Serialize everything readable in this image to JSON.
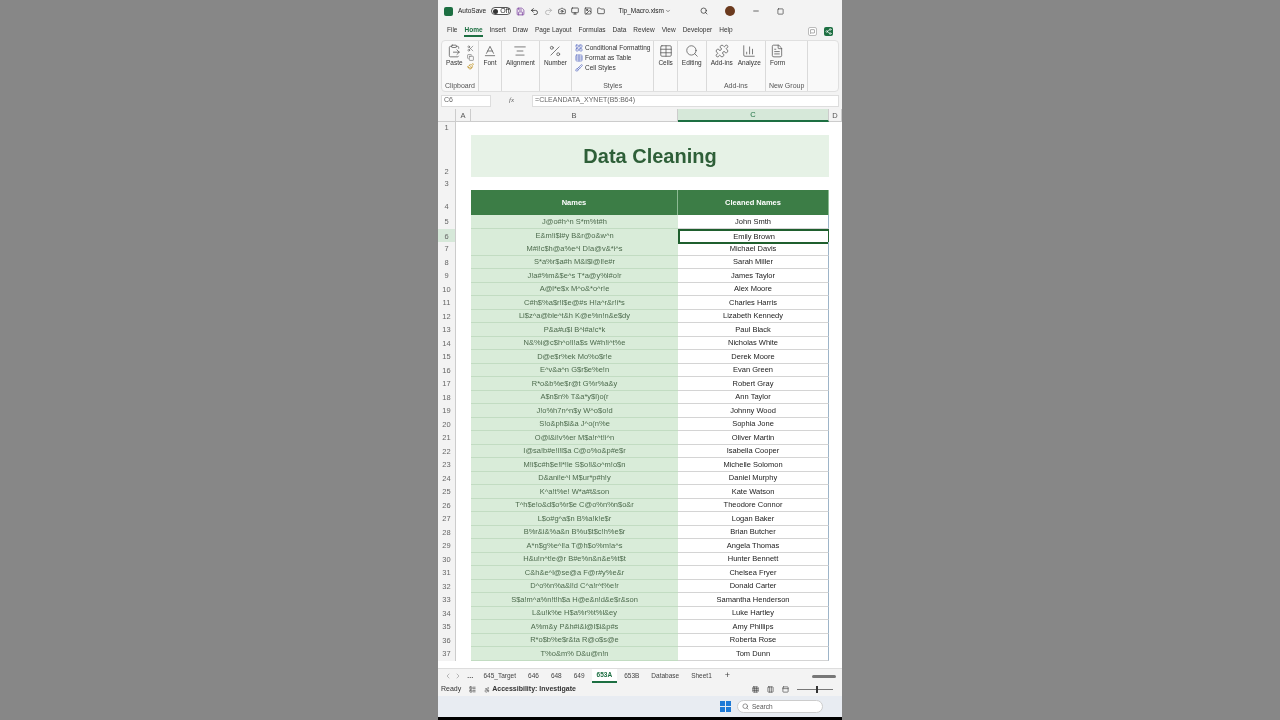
{
  "title_bar": {
    "autosave_label": "AutoSave",
    "autosave": {
      "on": false,
      "label": "Off"
    },
    "file_name": "Tip_Macro.xlsm"
  },
  "menu_tabs": [
    {
      "label": "File",
      "selected": false
    },
    {
      "label": "Home",
      "selected": true
    },
    {
      "label": "Insert",
      "selected": false
    },
    {
      "label": "Draw",
      "selected": false
    },
    {
      "label": "Page Layout",
      "selected": false
    },
    {
      "label": "Formulas",
      "selected": false
    },
    {
      "label": "Data",
      "selected": false
    },
    {
      "label": "Review",
      "selected": false
    },
    {
      "label": "View",
      "selected": false
    },
    {
      "label": "Developer",
      "selected": false
    },
    {
      "label": "Help",
      "selected": false
    }
  ],
  "ribbon": [
    {
      "kind": "clipboard",
      "label": "Clipboard",
      "buttons": [
        "Paste"
      ]
    },
    {
      "kind": "large",
      "buttons": [
        "Font"
      ]
    },
    {
      "kind": "large",
      "buttons": [
        "Alignment"
      ]
    },
    {
      "kind": "large",
      "buttons": [
        "Number"
      ]
    },
    {
      "kind": "list",
      "label": "Styles",
      "buttons": [
        "Conditional Formatting",
        "Format as Table",
        "Cell Styles"
      ]
    },
    {
      "kind": "large",
      "buttons": [
        "Cells"
      ]
    },
    {
      "kind": "large",
      "buttons": [
        "Editing"
      ]
    },
    {
      "kind": "large",
      "label": "Add-ins",
      "buttons": [
        "Add-ins",
        "Analyze"
      ]
    },
    {
      "kind": "large",
      "label": "New Group",
      "buttons": [
        "Form"
      ]
    }
  ],
  "formula_bar": {
    "name_box": "C6",
    "fx": "fx",
    "formula": "=CLEANDATA_XYNET(B5:B64)"
  },
  "sheet": {
    "columns": [
      {
        "label": "A",
        "selected": false
      },
      {
        "label": "B",
        "selected": false
      },
      {
        "label": "C",
        "selected": true
      },
      {
        "label": "D",
        "selected": false
      }
    ],
    "title_rows": [
      "1",
      "2",
      "3"
    ],
    "title": "Data Cleaning",
    "header_row": "4",
    "headers": [
      "Names",
      "Cleaned Names"
    ],
    "rows": [
      {
        "row": "5",
        "name": "J@o#h^n S*m%t#h",
        "cleaned": "John Smth",
        "selected": false
      },
      {
        "row": "6",
        "name": "E&m!i$l#y B&r@o&w^n",
        "cleaned": "Emily Brown",
        "selected": true
      },
      {
        "row": "7",
        "name": "M#i!c$h@a%e^l D!a@v&*i^s",
        "cleaned": "Michael Davis",
        "selected": false
      },
      {
        "row": "8",
        "name": "S*a%r$a#h M&i$l@l!e#r",
        "cleaned": "Sarah Miller",
        "selected": false
      },
      {
        "row": "9",
        "name": "J!a#%m&$e^s T*a@y%l#o!r",
        "cleaned": "James Taylor",
        "selected": false
      },
      {
        "row": "10",
        "name": "A@l*e$x M^o&*o^r!e",
        "cleaned": "Alex Moore",
        "selected": false
      },
      {
        "row": "11",
        "name": "C#h$%a$r!l$e@#s H!a^r&r!i*s",
        "cleaned": "Charles Harris",
        "selected": false
      },
      {
        "row": "12",
        "name": "Li$z^a@ble^t&h K@e%n!n&e$dy",
        "cleaned": "Lizabeth Kennedy",
        "selected": false
      },
      {
        "row": "13",
        "name": "P&a#u$l B^l#a!c*k",
        "cleaned": "Paul Black",
        "selected": false
      },
      {
        "row": "14",
        "name": "N&%i@c$h^o!l!a$s W#h!i^t%e",
        "cleaned": "Nicholas White",
        "selected": false
      },
      {
        "row": "15",
        "name": "D@e$r%ek Mo%o$r!e",
        "cleaned": "Derek Moore",
        "selected": false
      },
      {
        "row": "16",
        "name": "E^v&a^n G$r$e%e!n",
        "cleaned": "Evan Green",
        "selected": false
      },
      {
        "row": "17",
        "name": "R*o&b%e$r@t G%r%a&y",
        "cleaned": "Robert Gray",
        "selected": false
      },
      {
        "row": "18",
        "name": "A$n$n% T&a*y$l)o(r",
        "cleaned": "Ann Taylor",
        "selected": false
      },
      {
        "row": "19",
        "name": "J!o%h7n^n$y W^o$o!d",
        "cleaned": "Johnny Wood",
        "selected": false
      },
      {
        "row": "20",
        "name": "S!o&ph$i&a J^o(n%e",
        "cleaned": "Sophia Jone",
        "selected": false
      },
      {
        "row": "21",
        "name": "O@l&i!v%er M$a!r^t!i^n",
        "cleaned": "Oliver Martin",
        "selected": false
      },
      {
        "row": "22",
        "name": "I@sa!b#e!l!l$a C@o%o&p#e$r",
        "cleaned": "Isabella Cooper",
        "selected": false
      },
      {
        "row": "23",
        "name": "M!i$c#h$e!l*!le S$o!l&o^m!o$n",
        "cleaned": "Michelle Solomon",
        "selected": false
      },
      {
        "row": "24",
        "name": "D&ani!e^l M$ur*p#h!y",
        "cleaned": "Daniel Murphy",
        "selected": false
      },
      {
        "row": "25",
        "name": "K^a!t%e! W*a#t&son",
        "cleaned": "Kate Watson",
        "selected": false
      },
      {
        "row": "26",
        "name": "T^h$e!o&d$o%r$e C@o%n%n$o&r",
        "cleaned": "Theodore Connor",
        "selected": false
      },
      {
        "row": "27",
        "name": "L$o#g^a$n B%a!k!e$r",
        "cleaned": "Logan Baker",
        "selected": false
      },
      {
        "row": "28",
        "name": "B%r&i&%a&n B%u$t$c!h%e$r",
        "cleaned": "Brian Butcher",
        "selected": false
      },
      {
        "row": "29",
        "name": "A*n$g%e^l!a T@h$o%m!a^s",
        "cleaned": "Angela Thomas",
        "selected": false
      },
      {
        "row": "30",
        "name": "H&u!n^t!e@r B#e%n&n&e%t$t",
        "cleaned": "Hunter Bennett",
        "selected": false
      },
      {
        "row": "31",
        "name": "C&h&e^l@se@a F@r#y%e&r",
        "cleaned": "Chelsea Fryer",
        "selected": false
      },
      {
        "row": "32",
        "name": "D^o%n%a&l!d C^a!r^t%e!r",
        "cleaned": "Donald Carter",
        "selected": false
      },
      {
        "row": "33",
        "name": "S$a!m^a%n!t!h$a H@e&n!d&e$r&son",
        "cleaned": "Samantha Henderson",
        "selected": false
      },
      {
        "row": "34",
        "name": "L&u!k%e H$a%r%t%l&ey",
        "cleaned": "Luke Hartley",
        "selected": false
      },
      {
        "row": "35",
        "name": "A%m&y P&h#i&l@l$i&p#s",
        "cleaned": "Amy Phillips",
        "selected": false
      },
      {
        "row": "36",
        "name": "R*o$b%e$r&ta R@o$s@e",
        "cleaned": "Roberta Rose",
        "selected": false
      },
      {
        "row": "37",
        "name": "T%o&m% D&u@n!n",
        "cleaned": "Tom Dunn",
        "selected": false
      }
    ]
  },
  "sheet_tabs": {
    "more": "…",
    "tabs": [
      {
        "label": "645_Target",
        "selected": false
      },
      {
        "label": "646",
        "selected": false
      },
      {
        "label": "648",
        "selected": false
      },
      {
        "label": "649",
        "selected": false
      },
      {
        "label": "653A",
        "selected": true
      },
      {
        "label": "653B",
        "selected": false
      },
      {
        "label": "Database",
        "selected": false
      },
      {
        "label": "Sheet1",
        "selected": false
      }
    ],
    "add": "+"
  },
  "status_bar": {
    "status": "Ready",
    "accessibility": "Accessibility: Investigate",
    "zoom": {
      "level": 0.55
    }
  },
  "taskbar": {
    "search": "Search"
  }
}
